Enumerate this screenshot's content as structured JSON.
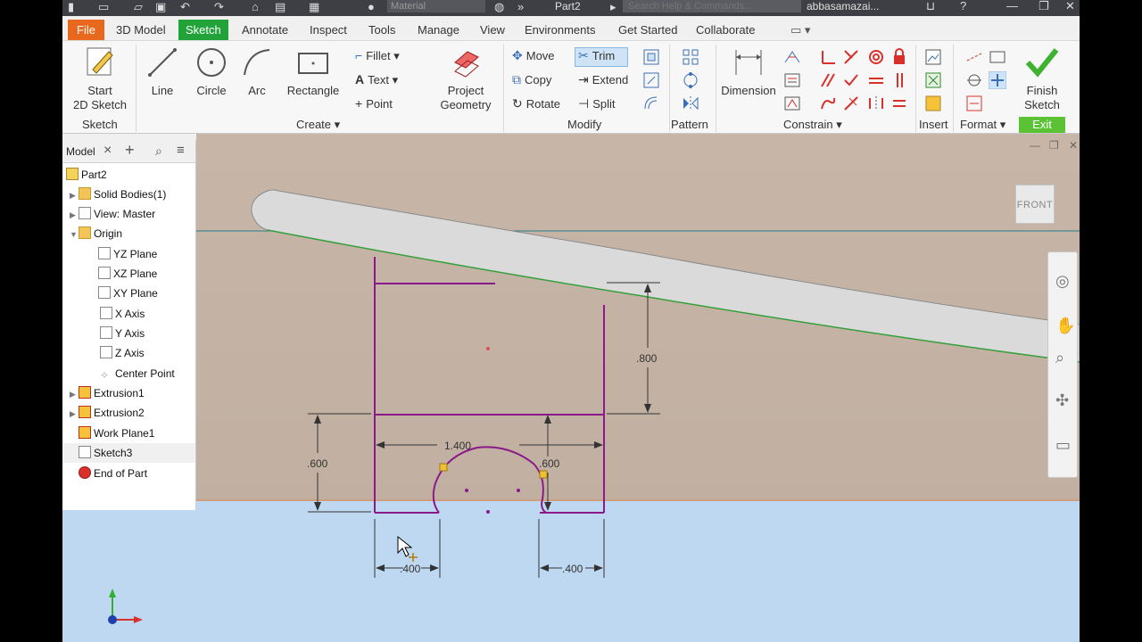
{
  "titlebar": {
    "filename": "Part2",
    "search_placeholder": "Search Help & Commands...",
    "material": "Material",
    "user": "abbasamazai..."
  },
  "tabs": [
    "File",
    "3D Model",
    "Sketch",
    "Annotate",
    "Inspect",
    "Tools",
    "Manage",
    "View",
    "Environments",
    "Get Started",
    "Collaborate"
  ],
  "ribbon": {
    "start_sketch": [
      "Start",
      "2D Sketch"
    ],
    "line": "Line",
    "circle": "Circle",
    "arc": "Arc",
    "rectangle": "Rectangle",
    "fillet": "Fillet",
    "text": "Text",
    "point": "Point",
    "project_geometry": [
      "Project",
      "Geometry"
    ],
    "move": "Move",
    "copy": "Copy",
    "rotate": "Rotate",
    "trim": "Trim",
    "extend": "Extend",
    "split": "Split",
    "dimension": "Dimension",
    "finish_sketch": [
      "Finish",
      "Sketch"
    ],
    "panels": {
      "sketch": "Sketch",
      "create": "Create",
      "modify": "Modify",
      "pattern": "Pattern",
      "constrain": "Constrain",
      "insert": "Insert",
      "format": "Format",
      "exit": "Exit"
    }
  },
  "browser": {
    "tab_label": "Model",
    "items": [
      {
        "label": "Part2"
      },
      {
        "label": "Solid Bodies(1)"
      },
      {
        "label": "View: Master"
      },
      {
        "label": "Origin"
      },
      {
        "label": "YZ Plane"
      },
      {
        "label": "XZ Plane"
      },
      {
        "label": "XY Plane"
      },
      {
        "label": "X Axis"
      },
      {
        "label": "Y Axis"
      },
      {
        "label": "Z Axis"
      },
      {
        "label": "Center Point"
      },
      {
        "label": "Extrusion1"
      },
      {
        "label": "Extrusion2"
      },
      {
        "label": "Work Plane1"
      },
      {
        "label": "Sketch3"
      },
      {
        "label": "End of Part"
      }
    ]
  },
  "viewport": {
    "viewcube_label": "FRONT",
    "dimensions": {
      "height_top": ".800",
      "width_overall": "1.400",
      "height_left": ".600",
      "height_right": ".600",
      "bottom_left": ".400",
      "bottom_right": ".400"
    },
    "triad": {
      "x": "X",
      "y": "Y"
    }
  },
  "colors": {
    "sketch_line": "#8a1a8a",
    "file_tab": "#e8691e",
    "sketch_tab": "#22a33a",
    "exit_panel": "#5bc236",
    "viewport_top": "#c4b3a6",
    "viewport_bottom": "#bcd6f0"
  }
}
